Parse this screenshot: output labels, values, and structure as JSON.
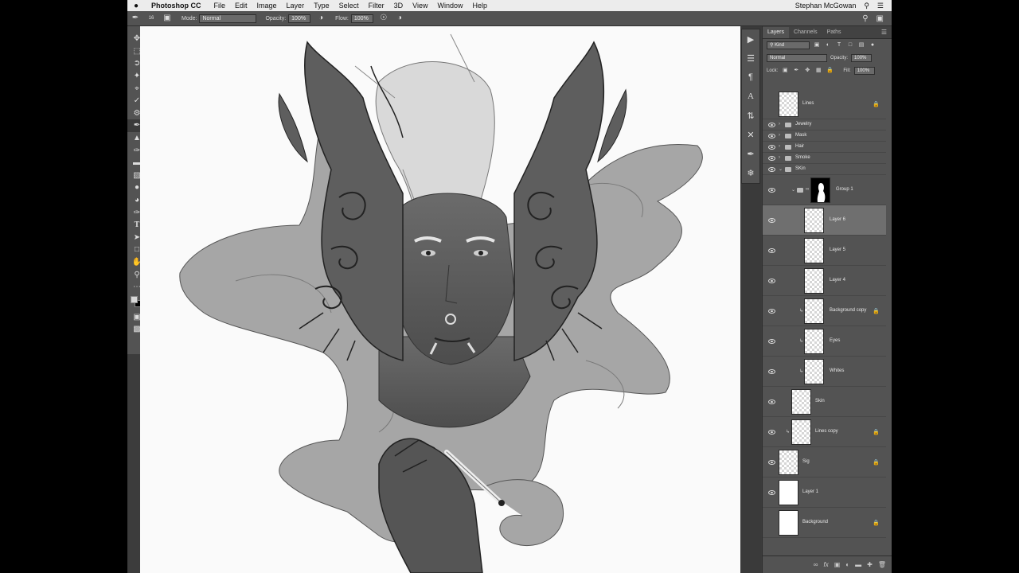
{
  "menubar": {
    "app_name": "Photoshop CC",
    "items": [
      "File",
      "Edit",
      "Image",
      "Layer",
      "Type",
      "Select",
      "Filter",
      "3D",
      "View",
      "Window",
      "Help"
    ],
    "user": "Stephan McGowan"
  },
  "options": {
    "brush_size": "16",
    "mode_label": "Mode:",
    "mode_value": "Normal",
    "opacity_label": "Opacity:",
    "opacity_value": "100%",
    "flow_label": "Flow:",
    "flow_value": "100%"
  },
  "tools": [
    "move-icon",
    "marquee-icon",
    "lasso-icon",
    "magic-wand-icon",
    "crop-icon",
    "eyedropper-icon",
    "healing-icon",
    "brush-icon",
    "stamp-icon",
    "history-brush-icon",
    "eraser-icon",
    "gradient-icon",
    "blur-icon",
    "dodge-icon",
    "pen-icon",
    "type-icon",
    "path-select-icon",
    "shape-icon",
    "hand-icon",
    "zoom-icon",
    "more-tools-icon"
  ],
  "layers_panel": {
    "tabs": [
      "Layers",
      "Channels",
      "Paths"
    ],
    "filter_kind": "Kind",
    "blend_mode": "Normal",
    "opacity_label": "Opacity:",
    "opacity_value": "100%",
    "lock_label": "Lock:",
    "fill_label": "Fill:",
    "fill_value": "100%",
    "layers": [
      {
        "name": "Lines",
        "type": "layer",
        "visible": false,
        "locked": true
      },
      {
        "name": "Jewelry",
        "type": "group",
        "visible": true,
        "expanded": false
      },
      {
        "name": "Mask",
        "type": "group",
        "visible": true,
        "expanded": false
      },
      {
        "name": "Hair",
        "type": "group",
        "visible": true,
        "expanded": false
      },
      {
        "name": "Smoke",
        "type": "group",
        "visible": true,
        "expanded": false
      },
      {
        "name": "SKin",
        "type": "group",
        "visible": true,
        "expanded": true
      },
      {
        "name": "Group 1",
        "type": "group",
        "visible": true,
        "expanded": true,
        "has_mask": true
      },
      {
        "name": "Layer 6",
        "type": "layer",
        "visible": true,
        "selected": true
      },
      {
        "name": "Layer 5",
        "type": "layer",
        "visible": true
      },
      {
        "name": "Layer 4",
        "type": "layer",
        "visible": true
      },
      {
        "name": "Background copy",
        "type": "layer",
        "visible": true,
        "clipped": true,
        "locked": true
      },
      {
        "name": "Eyes",
        "type": "layer",
        "visible": true,
        "clipped": true
      },
      {
        "name": "Whites",
        "type": "layer",
        "visible": true,
        "clipped": true
      },
      {
        "name": "Skin",
        "type": "layer",
        "visible": true
      },
      {
        "name": "Lines copy",
        "type": "layer",
        "visible": true,
        "clipped": true,
        "locked": true
      },
      {
        "name": "Sig",
        "type": "layer",
        "visible": true,
        "locked": true
      },
      {
        "name": "Layer 1",
        "type": "layer",
        "visible": true
      },
      {
        "name": "Background",
        "type": "layer",
        "visible": false,
        "locked": true
      }
    ]
  }
}
